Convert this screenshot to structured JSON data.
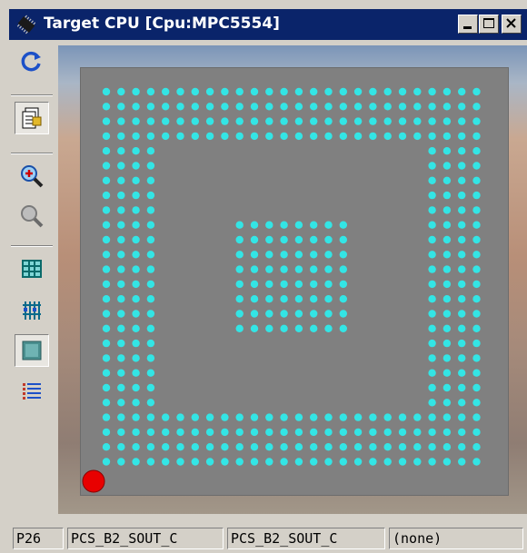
{
  "window": {
    "title": "Target CPU [Cpu:MPC5554]",
    "controls": [
      "minimize",
      "maximize",
      "close"
    ]
  },
  "toolbar": {
    "tools": [
      {
        "name": "refresh-button",
        "icon": "refresh-icon",
        "pressed": false
      },
      {
        "name": "properties-button",
        "icon": "properties-icon",
        "pressed": true
      },
      {
        "name": "zoom-in-button",
        "icon": "zoom-in-icon",
        "pressed": false
      },
      {
        "name": "zoom-out-button",
        "icon": "zoom-out-icon",
        "pressed": false
      },
      {
        "name": "grid-view-button",
        "icon": "grid-icon",
        "pressed": false
      },
      {
        "name": "signal-view-button",
        "icon": "signal-icon",
        "pressed": false
      },
      {
        "name": "package-view-button",
        "icon": "package-icon",
        "pressed": true
      },
      {
        "name": "list-view-button",
        "icon": "list-icon",
        "pressed": false
      }
    ]
  },
  "package": {
    "pin_color": "#33e5e5",
    "body_color": "#808080",
    "selected_pin_color": "#e80000",
    "ball_grid_size": 26,
    "outer_ring_rows": 4,
    "center_block_size": 8
  },
  "status": {
    "pin": "P26",
    "signal1": "PCS_B2_SOUT_C",
    "signal2": "PCS_B2_SOUT_C",
    "assignment": "(none)"
  }
}
